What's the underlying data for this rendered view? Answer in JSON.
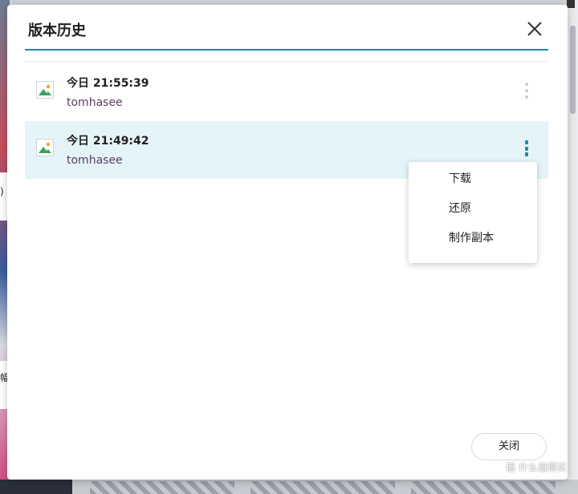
{
  "dialog": {
    "title": "版本历史",
    "close_button_label": "关闭"
  },
  "versions": [
    {
      "time": "今日 21:55:39",
      "user": "tomhasee",
      "selected": false
    },
    {
      "time": "今日 21:49:42",
      "user": "tomhasee",
      "selected": true
    }
  ],
  "context_menu": {
    "items": [
      "下载",
      "还原",
      "制作副本"
    ]
  },
  "background": {
    "left_glyph_1": ")",
    "left_glyph_2": "幅"
  },
  "watermark": "值 什么值得买",
  "icons": {
    "close": "close-icon",
    "file": "image-file-icon",
    "more": "more-vertical-icon"
  },
  "colors": {
    "accent": "#1b8ea0",
    "selected_row": "#e4f4f8",
    "username": "#5c3d62"
  }
}
